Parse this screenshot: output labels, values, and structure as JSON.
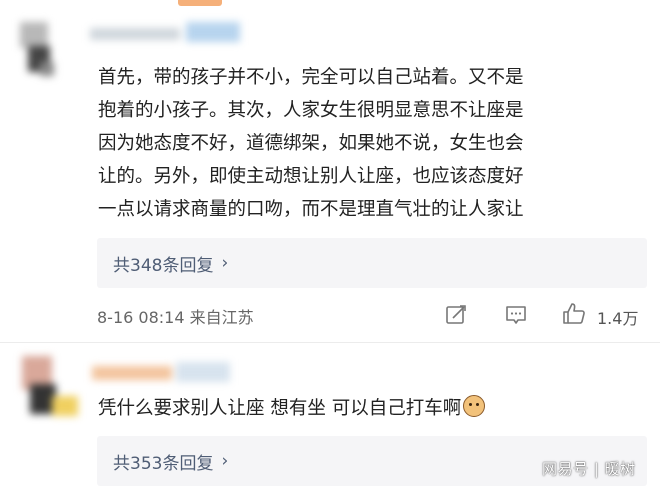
{
  "comments": [
    {
      "text_lines": [
        "首先，带的孩子并不小，完全可以自己站着。又不是",
        "抱着的小孩子。其次，人家女生很明显意思不让座是",
        "因为她态度不好，道德绑架，如果她不说，女生也会",
        "让的。另外，即使主动想让别人让座，也应该态度好",
        "一点以请求商量的口吻，而不是理直气壮的让人家让"
      ],
      "replies_label": "共348条回复",
      "meta": "8-16 08:14 来自江苏",
      "like_count": "1.4万"
    },
    {
      "text": "凭什么要求别人让座 想有坐 可以自己打车啊",
      "emoji": "cat-face-icon",
      "replies_label": "共353条回复"
    }
  ],
  "watermark": "网易号 | 暖树",
  "colors": {
    "reply_box_bg": "#f5f5f7",
    "reply_text": "#4f5d75",
    "meta_text": "#666666"
  }
}
